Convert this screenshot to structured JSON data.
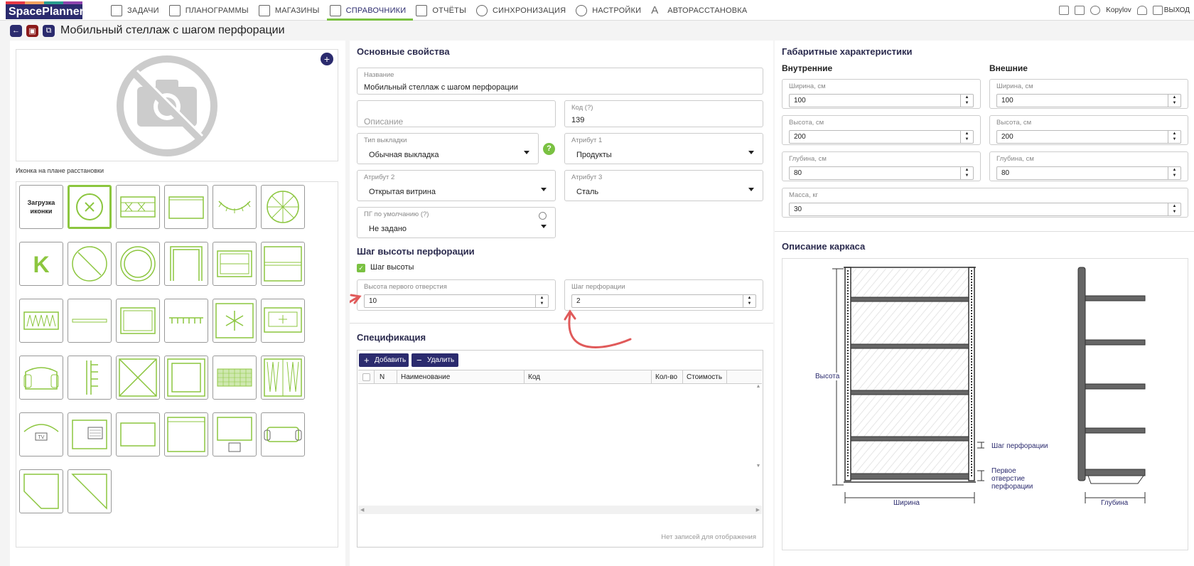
{
  "nav": {
    "logo": "SpacePlanner",
    "items": [
      {
        "label": "ЗАДАЧИ",
        "icon": "tasks-icon"
      },
      {
        "label": "ПЛАНОГРАММЫ",
        "icon": "planogram-icon"
      },
      {
        "label": "МАГАЗИНЫ",
        "icon": "store-icon"
      },
      {
        "label": "СПРАВОЧНИКИ",
        "icon": "folder-icon"
      },
      {
        "label": "ОТЧЁТЫ",
        "icon": "report-icon"
      },
      {
        "label": "СИНХРОНИЗАЦИЯ",
        "icon": "sync-icon"
      },
      {
        "label": "НАСТРОЙКИ",
        "icon": "gear-icon"
      },
      {
        "label": "АВТОРАССТАНОВКА",
        "icon": "font-a-icon"
      }
    ],
    "active_index": 3,
    "user": "Kopylov",
    "logout": "ВЫХОД"
  },
  "title": "Мобильный стеллаж с шагом перфорации",
  "left": {
    "icon_caption": "Иконка на плане расстановки",
    "upload_label": "Загрузка иконки"
  },
  "basic": {
    "heading": "Основные свойства",
    "name_label": "Название",
    "name_value": "Мобильный стеллаж с шагом перфорации",
    "desc_placeholder": "Описание",
    "code_label": "Код (?)",
    "code_value": "139",
    "layout_type_label": "Тип выкладки",
    "layout_type_value": "Обычная выкладка",
    "attr1_label": "Атрибут 1",
    "attr1_value": "Продукты",
    "attr2_label": "Атрибут 2",
    "attr2_value": "Открытая витрина",
    "attr3_label": "Атрибут 3",
    "attr3_value": "Сталь",
    "pg_label": "ПГ по умолчанию (?)",
    "pg_value": "Не задано",
    "help_symbol": "?"
  },
  "perf": {
    "heading": "Шаг высоты перфорации",
    "checkbox_label": "Шаг высоты",
    "checked": true,
    "first_hole_label": "Высота первого отверстия",
    "first_hole_value": "10",
    "step_label": "Шаг перфорации",
    "step_value": "2"
  },
  "spec": {
    "heading": "Спецификация",
    "add_label": "Добавить",
    "delete_label": "Удалить",
    "columns": [
      "N",
      "Наименование",
      "Код",
      "Кол-во",
      "Стоимость"
    ],
    "empty_text": "Нет записей для отображения"
  },
  "dims": {
    "heading": "Габаритные характеристики",
    "inner_heading": "Внутренние",
    "outer_heading": "Внешние",
    "inner": [
      {
        "label": "Ширина, см",
        "value": "100"
      },
      {
        "label": "Высота, см",
        "value": "200"
      },
      {
        "label": "Глубина, см",
        "value": "80"
      }
    ],
    "outer": [
      {
        "label": "Ширина, см",
        "value": "100"
      },
      {
        "label": "Высота, см",
        "value": "200"
      },
      {
        "label": "Глубина, см",
        "value": "80"
      }
    ],
    "mass_label": "Масса, кг",
    "mass_value": "30"
  },
  "frame": {
    "heading": "Описание каркаса",
    "height_label": "Высота",
    "width_label": "Ширина",
    "depth_label": "Глубина",
    "step_label": "Шаг перфорации",
    "first_hole_label": "Первое отверстие перфорации"
  },
  "colors": {
    "accent": "#2b2b6e",
    "green": "#7ac142"
  }
}
